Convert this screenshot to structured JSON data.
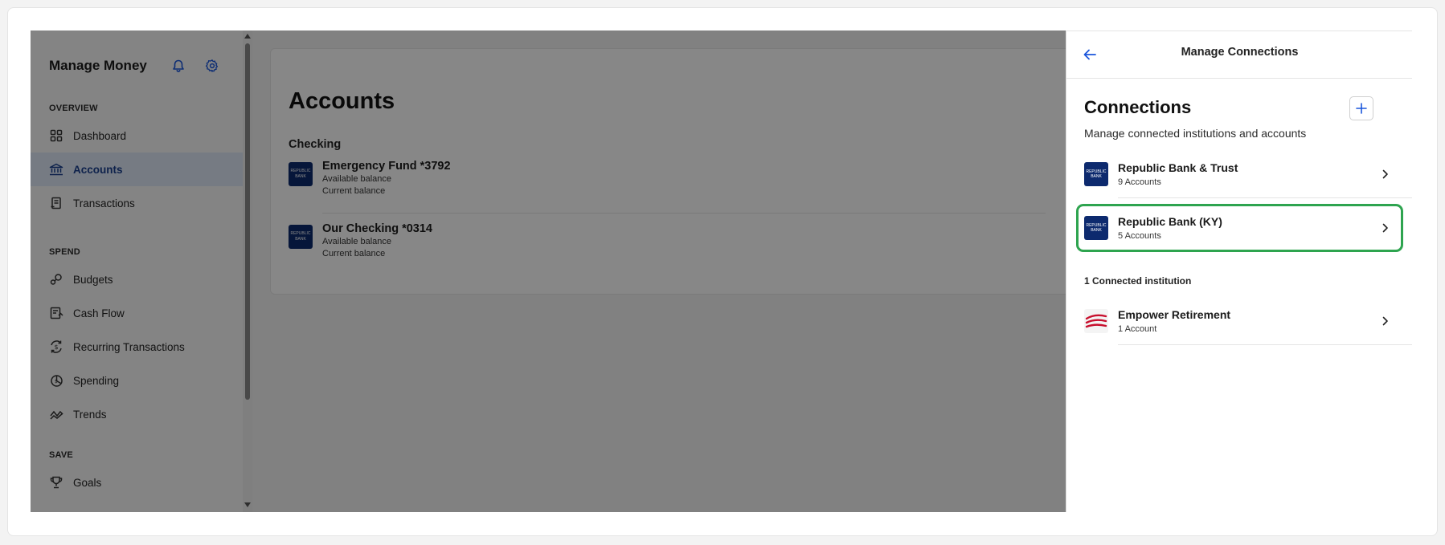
{
  "sidebar": {
    "title": "Manage Money",
    "icons": {
      "bell": "bell-icon",
      "settings": "gear-icon"
    },
    "sections": [
      {
        "label": "OVERVIEW"
      },
      {
        "label": "SPEND"
      },
      {
        "label": "SAVE"
      }
    ],
    "items": [
      {
        "label": "Dashboard",
        "icon": "dashboard-icon",
        "active": false
      },
      {
        "label": "Accounts",
        "icon": "bank-icon",
        "active": true
      },
      {
        "label": "Transactions",
        "icon": "receipt-icon",
        "active": false
      },
      {
        "label": "Budgets",
        "icon": "budgets-icon",
        "active": false
      },
      {
        "label": "Cash Flow",
        "icon": "cash-flow-icon",
        "active": false
      },
      {
        "label": "Recurring Transactions",
        "icon": "recurring-icon",
        "active": false
      },
      {
        "label": "Spending",
        "icon": "spending-icon",
        "active": false
      },
      {
        "label": "Trends",
        "icon": "trends-icon",
        "active": false
      },
      {
        "label": "Goals",
        "icon": "trophy-icon",
        "active": false
      }
    ]
  },
  "main": {
    "title": "Accounts",
    "group": "Checking",
    "accounts": [
      {
        "name": "Emergency Fund *3792",
        "available": "Available balance",
        "current": "Current balance",
        "logo_text": "REPUBLIC BANK"
      },
      {
        "name": "Our Checking *0314",
        "available": "Available balance",
        "current": "Current balance",
        "logo_text": "REPUBLIC BANK"
      }
    ]
  },
  "panel": {
    "header_title": "Manage Connections",
    "title": "Connections",
    "subtitle": "Manage connected institutions and accounts",
    "institutions": [
      {
        "name": "Republic Bank & Trust",
        "count": "9 Accounts",
        "logo_text": "REPUBLIC BANK",
        "highlighted": false
      },
      {
        "name": "Republic Bank (KY)",
        "count": "5 Accounts",
        "logo_text": "REPUBLIC BANK",
        "highlighted": true
      }
    ],
    "connected_label": "1 Connected institution",
    "connected": [
      {
        "name": "Empower Retirement",
        "count": "1 Account"
      }
    ]
  },
  "colors": {
    "accent": "#1a56db",
    "active_bg": "#dfe8f7",
    "highlight": "#2ea44f",
    "bank_navy": "#0d2a6e",
    "empower_red": "#c8102e"
  }
}
